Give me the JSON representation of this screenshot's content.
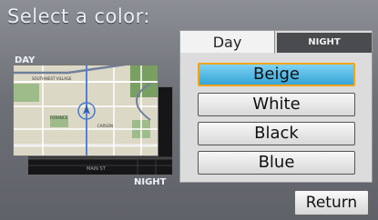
{
  "title": "Select a color:",
  "preview": {
    "day_label": "DAY",
    "night_label": "NIGHT",
    "map_labels": [
      "SOUTHWEST VILLAGE",
      "FORANCE",
      "CARSON",
      "MAIN ST"
    ]
  },
  "tabs": {
    "day": "Day",
    "night": "NIGHT"
  },
  "options": [
    "Beige",
    "White",
    "Black",
    "Blue"
  ],
  "selected_option": "Beige",
  "return_label": "Return",
  "colors": {
    "selected_fill": "#35a4d6",
    "selected_border": "#f1a31a",
    "night_tab": "#4a4b4f"
  }
}
